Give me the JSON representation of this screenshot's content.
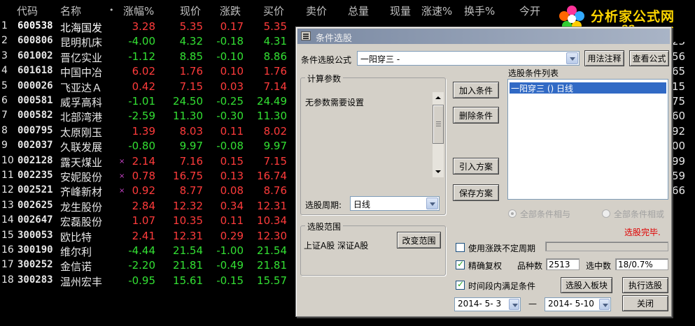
{
  "table": {
    "headers": [
      "代码",
      "名称",
      "•",
      "涨幅%",
      "现价",
      "涨跌",
      "买价",
      "卖价",
      "总量",
      "现量",
      "涨速%",
      "换手%",
      "今开"
    ],
    "rows": [
      {
        "idx": "1",
        "code": "600538",
        "name": "北海国发",
        "mark": "",
        "chg": "3.28",
        "price": "5.35",
        "diff": "0.17",
        "bid": "5.35",
        "dir": "up",
        "right": ""
      },
      {
        "idx": "2",
        "code": "600806",
        "name": "昆明机床",
        "mark": "",
        "chg": "-4.00",
        "price": "4.32",
        "diff": "-0.18",
        "bid": "4.31",
        "dir": "down",
        "right": "23"
      },
      {
        "idx": "3",
        "code": "601002",
        "name": "晋亿实业",
        "mark": "",
        "chg": "-1.12",
        "price": "8.85",
        "diff": "-0.10",
        "bid": "8.86",
        "dir": "down",
        "right": "56"
      },
      {
        "idx": "4",
        "code": "601618",
        "name": "中国中冶",
        "mark": "",
        "chg": "6.02",
        "price": "1.76",
        "diff": "0.10",
        "bid": "1.76",
        "dir": "up",
        "right": "65"
      },
      {
        "idx": "5",
        "code": "000026",
        "name": "飞亚达Ａ",
        "mark": "",
        "chg": "0.42",
        "price": "7.15",
        "diff": "0.03",
        "bid": "7.14",
        "dir": "up",
        "right": "15"
      },
      {
        "idx": "6",
        "code": "000581",
        "name": "威孚高科",
        "mark": "",
        "chg": "-1.01",
        "price": "24.50",
        "diff": "-0.25",
        "bid": "24.49",
        "dir": "down",
        "right": "75"
      },
      {
        "idx": "7",
        "code": "000582",
        "name": "北部湾港",
        "mark": "",
        "chg": "-2.59",
        "price": "11.30",
        "diff": "-0.30",
        "bid": "11.30",
        "dir": "down",
        "right": "60"
      },
      {
        "idx": "8",
        "code": "000795",
        "name": "太原刚玉",
        "mark": "",
        "chg": "1.39",
        "price": "8.03",
        "diff": "0.11",
        "bid": "8.02",
        "dir": "up",
        "right": "92"
      },
      {
        "idx": "9",
        "code": "002037",
        "name": "久联发展",
        "mark": "",
        "chg": "-0.80",
        "price": "9.97",
        "diff": "-0.08",
        "bid": "9.97",
        "dir": "down",
        "right": "00"
      },
      {
        "idx": "10",
        "code": "002128",
        "name": "露天煤业",
        "mark": "×",
        "chg": "2.14",
        "price": "7.16",
        "diff": "0.15",
        "bid": "7.15",
        "dir": "up",
        "right": "99"
      },
      {
        "idx": "11",
        "code": "002235",
        "name": "安妮股份",
        "mark": "×",
        "chg": "0.78",
        "price": "16.75",
        "diff": "0.13",
        "bid": "16.74",
        "dir": "up",
        "right": "59"
      },
      {
        "idx": "12",
        "code": "002521",
        "name": "齐峰新材",
        "mark": "×",
        "chg": "0.92",
        "price": "8.77",
        "diff": "0.08",
        "bid": "8.76",
        "dir": "up",
        "right": "66"
      },
      {
        "idx": "13",
        "code": "002625",
        "name": "龙生股份",
        "mark": "",
        "chg": "2.84",
        "price": "12.32",
        "diff": "0.34",
        "bid": "12.31",
        "dir": "up",
        "right": ""
      },
      {
        "idx": "14",
        "code": "002647",
        "name": "宏磊股份",
        "mark": "",
        "chg": "1.07",
        "price": "10.35",
        "diff": "0.11",
        "bid": "10.34",
        "dir": "up",
        "right": ""
      },
      {
        "idx": "15",
        "code": "300053",
        "name": "欧比特",
        "mark": "",
        "chg": "2.41",
        "price": "12.31",
        "diff": "0.29",
        "bid": "12.30",
        "dir": "up",
        "right": ""
      },
      {
        "idx": "16",
        "code": "300190",
        "name": "维尔利",
        "mark": "",
        "chg": "-4.44",
        "price": "21.54",
        "diff": "-1.00",
        "bid": "21.54",
        "dir": "down",
        "right": ""
      },
      {
        "idx": "17",
        "code": "300252",
        "name": "金信诺",
        "mark": "",
        "chg": "-2.20",
        "price": "21.81",
        "diff": "-0.49",
        "bid": "21.81",
        "dir": "down",
        "right": ""
      },
      {
        "idx": "18",
        "code": "300283",
        "name": "温州宏丰",
        "mark": "",
        "chg": "-0.95",
        "price": "15.61",
        "diff": "-0.15",
        "bid": "15.57",
        "dir": "down",
        "right": ""
      }
    ]
  },
  "logo": {
    "text": "分析家公式网",
    "url": "www.88gs.com"
  },
  "dialog": {
    "title": "条件选股",
    "formula_label": "条件选股公式",
    "formula_value": "一阳穿三 -",
    "usage_btn": "用法注释",
    "view_btn": "查看公式",
    "params_group": "计算参数",
    "params_text": "无参数需要设置",
    "period_label": "选股周期:",
    "period_value": "日线",
    "range_group": "选股范围",
    "range_text": "上证A股  深证A股",
    "change_range_btn": "改变范围",
    "add_btn": "加入条件",
    "delete_btn": "删除条件",
    "import_btn": "引入方案",
    "save_btn": "保存方案",
    "list_label": "选股条件列表",
    "list_item": "一阳穿三  () 日线",
    "radio_and": "全部条件相与",
    "radio_or": "全部条件相或",
    "status": "选股完毕.",
    "opt_float": "使用涨跌不定周期",
    "opt_exact": "精确复权",
    "count_label": "品种数",
    "count_value": "2513",
    "selected_label": "选中数",
    "selected_value": "18/0.7%",
    "opt_time": "时间段内满足条件",
    "to_block_btn": "选股入板块",
    "run_btn": "执行选股",
    "date_from": "2014- 5- 3",
    "date_sep": "—",
    "date_to": "2014- 5-10",
    "close_btn": "关闭"
  }
}
